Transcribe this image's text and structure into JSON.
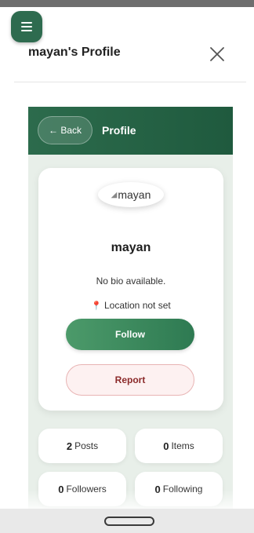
{
  "modal": {
    "title": "mayan's Profile"
  },
  "panel": {
    "back_label": "← Back",
    "title": "Profile"
  },
  "profile": {
    "avatar_alt": "mayan",
    "username": "mayan",
    "bio": "No bio available.",
    "location": "Location not set",
    "follow_label": "Follow",
    "report_label": "Report"
  },
  "stats": {
    "posts": {
      "count": "2",
      "label": "Posts"
    },
    "items": {
      "count": "0",
      "label": "Items"
    },
    "followers": {
      "count": "0",
      "label": "Followers"
    },
    "following": {
      "count": "0",
      "label": "Following"
    }
  },
  "icons": {
    "menu": "hamburger-icon",
    "close": "close-icon",
    "location": "map-pin-icon",
    "avatar": "broken-image-icon"
  },
  "colors": {
    "accent": "#2e6b4f",
    "header": "#1f5a3e",
    "report_text": "#8b2a2a"
  }
}
